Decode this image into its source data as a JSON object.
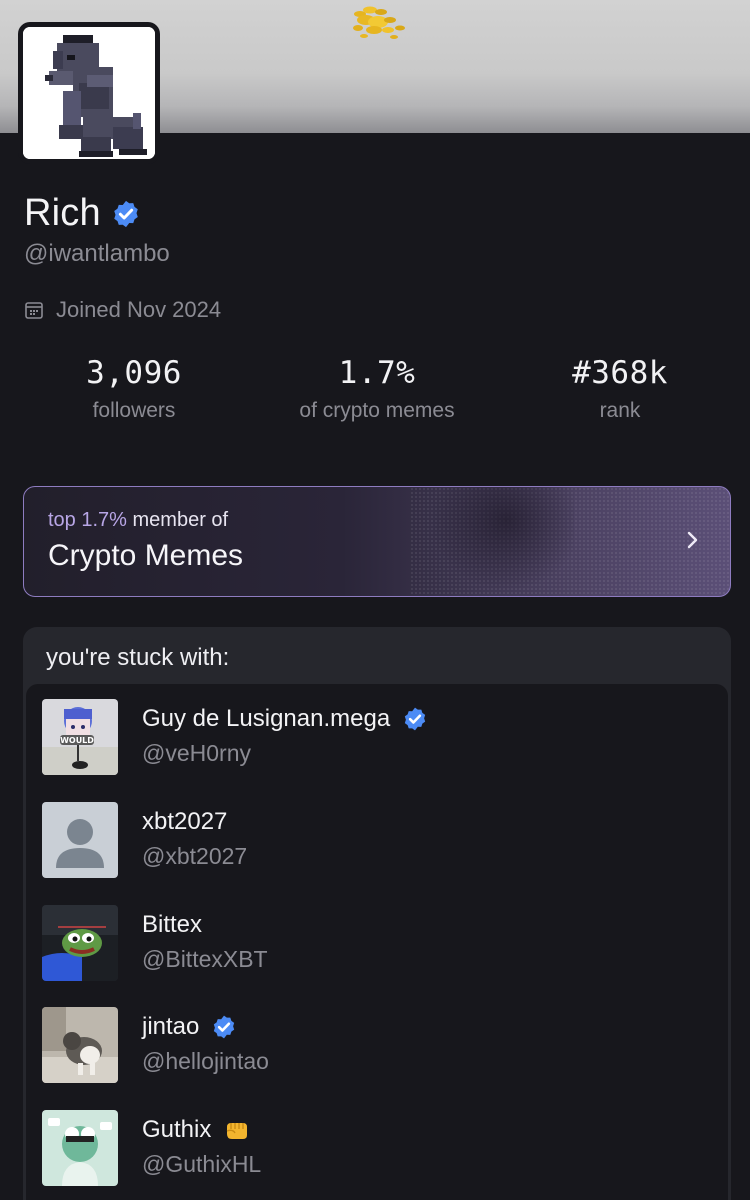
{
  "profile": {
    "name": "Rich",
    "handle": "@iwantlambo",
    "joined": "Joined Nov 2024",
    "avatar_icon": "pixel-gorilla",
    "verified": true
  },
  "stats": [
    {
      "value": "3,096",
      "label": "followers"
    },
    {
      "value": "1.7%",
      "label": "of crypto memes"
    },
    {
      "value": "#368k",
      "label": "rank"
    }
  ],
  "community": {
    "top_prefix": "top 1.7%",
    "top_suffix": "member of",
    "name": "Crypto Memes",
    "accent": "#8e7cc0"
  },
  "stuck_with": {
    "title": "you're stuck with:",
    "users": [
      {
        "name": "Guy de Lusignan.mega",
        "handle": "@veH0rny",
        "badge": "verified-icon"
      },
      {
        "name": "xbt2027",
        "handle": "@xbt2027",
        "badge": ""
      },
      {
        "name": "Bittex",
        "handle": "@BittexXBT",
        "badge": ""
      },
      {
        "name": "jintao",
        "handle": "@hellojintao",
        "badge": "verified-icon"
      },
      {
        "name": "Guthix",
        "handle": "@GuthixHL",
        "badge": "flexed-fist-emoji"
      }
    ]
  },
  "avatar_text": {
    "user1": "WOULD"
  },
  "colors": {
    "background": "#17171c",
    "muted_text": "#8b8b93",
    "verified_blue": "#4c8bf5"
  }
}
